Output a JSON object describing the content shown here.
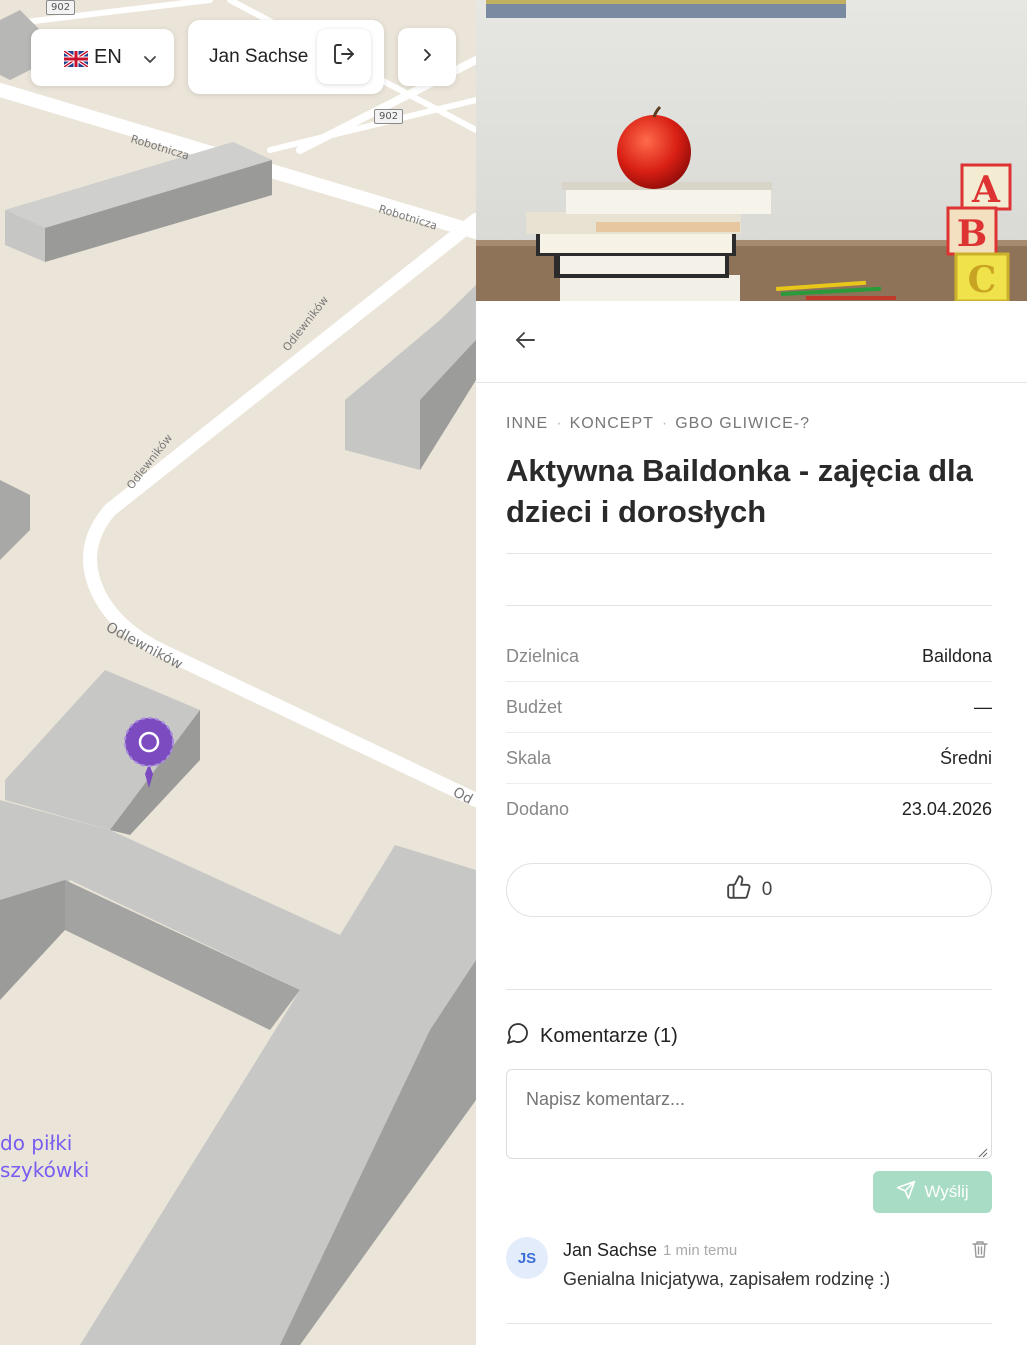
{
  "map": {
    "road_shield_a": "902",
    "road_shield_b": "902",
    "street_robotnicza_1": "Robotnicza",
    "street_robotnicza_2": "Robotnicza",
    "street_odlewnikow_1": "Odlewników",
    "street_odlewnikow_2": "Odlewników",
    "street_odlewnikow_3": "Odlewników",
    "street_od_cut": "Od",
    "poi_label_line1": "do piłki",
    "poi_label_line2": "szykówki",
    "pin_color": "#7b4bbf"
  },
  "topbar": {
    "language_code": "EN",
    "user_name": "Jan Sachse"
  },
  "project": {
    "breadcrumbs": [
      "INNE",
      "KONCEPT",
      "GBO GLIWICE-?"
    ],
    "title": "Aktywna Baildonka - zajęcia dla dzieci i dorosłych",
    "details": [
      {
        "label": "Dzielnica",
        "value": "Baildona"
      },
      {
        "label": "Budżet",
        "value": "—"
      },
      {
        "label": "Skala",
        "value": "Średni"
      },
      {
        "label": "Dodano",
        "value": "23.04.2026"
      }
    ],
    "likes": "0"
  },
  "comments": {
    "heading": "Komentarze (1)",
    "input_placeholder": "Napisz komentarz...",
    "send_label": "Wyślij",
    "send_color": "#a8dcc4",
    "items": [
      {
        "initials": "JS",
        "author": "Jan Sachse",
        "time": "1 min temu",
        "text": "Genialna Inicjatywa, zapisałem rodzinę :)"
      }
    ]
  }
}
